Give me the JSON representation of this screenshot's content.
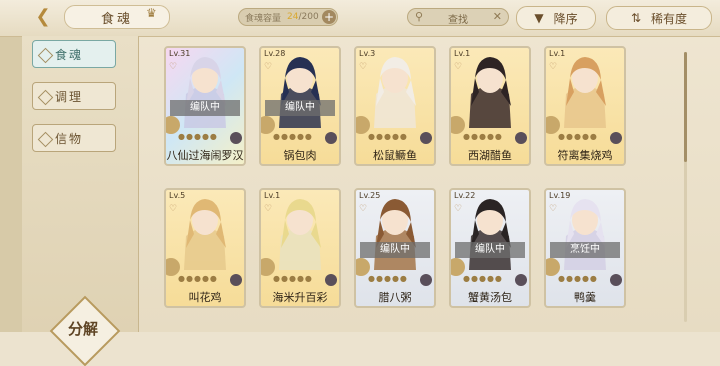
{
  "header": {
    "title": "食魂",
    "capacity_label": "食魂容量",
    "capacity_current": "24",
    "capacity_max": "/200",
    "search_label": "查找",
    "sort_label": "降序",
    "rarity_label": "稀有度"
  },
  "sidebar": {
    "tabs": [
      {
        "label": "食魂",
        "active": true
      },
      {
        "label": "调理",
        "active": false
      },
      {
        "label": "信物",
        "active": false
      }
    ],
    "decompose_label": "分解"
  },
  "cards": [
    {
      "level": "Lv.31",
      "name": "八仙过海闹罗汉",
      "status": "编队中",
      "bg": [
        "#f7d7f0",
        "#cfe7f5",
        "#f4f0c8"
      ],
      "art": "#c9c9e4",
      "hair": "#d8d4e8"
    },
    {
      "level": "Lv.28",
      "name": "锅包肉",
      "status": "编队中",
      "bg": [
        "#fbe9b8",
        "#f6dc98"
      ],
      "art": "#2d3350",
      "hair": "#263053"
    },
    {
      "level": "Lv.3",
      "name": "松鼠鳜鱼",
      "status": "",
      "bg": [
        "#fbe9b8",
        "#f6dc98"
      ],
      "art": "#f0e6d8",
      "hair": "#f2ede5"
    },
    {
      "level": "Lv.1",
      "name": "西湖醋鱼",
      "status": "",
      "bg": [
        "#fbe9b8",
        "#f6dc98"
      ],
      "art": "#3b2b2b",
      "hair": "#2e2424"
    },
    {
      "level": "Lv.1",
      "name": "符离集烧鸡",
      "status": "",
      "bg": [
        "#fbe9b8",
        "#f6dc98"
      ],
      "art": "#e8c68c",
      "hair": "#d8a060"
    },
    {
      "level": "Lv.5",
      "name": "叫花鸡",
      "status": "",
      "bg": [
        "#fbe9b8",
        "#f6dc98"
      ],
      "art": "#e6c98c",
      "hair": "#e0b874"
    },
    {
      "level": "Lv.1",
      "name": "海米升百彩",
      "status": "",
      "bg": [
        "#fbe9b8",
        "#f6dc98"
      ],
      "art": "#e9e2c0",
      "hair": "#e9d98e"
    },
    {
      "level": "Lv.25",
      "name": "腊八粥",
      "status": "编队中",
      "bg": [
        "#eef0f4",
        "#dfe3ea"
      ],
      "art": "#a57549",
      "hair": "#8a5a34"
    },
    {
      "level": "Lv.22",
      "name": "蟹黄汤包",
      "status": "编队中",
      "bg": [
        "#eef0f4",
        "#dfe3ea"
      ],
      "art": "#3a3030",
      "hair": "#2a2424"
    },
    {
      "level": "Lv.19",
      "name": "鸭羹",
      "status": "烹饪中",
      "bg": [
        "#eef0f4",
        "#dfe3ea"
      ],
      "art": "#d4cfe4",
      "hair": "#e6e2f0"
    }
  ],
  "icons": {
    "back": "back-arrow-icon",
    "crown": "crown-icon",
    "plus": "plus-icon",
    "search": "search-icon",
    "clear": "close-icon",
    "sort": "sort-down-icon",
    "rarity": "rarity-sort-icon"
  }
}
